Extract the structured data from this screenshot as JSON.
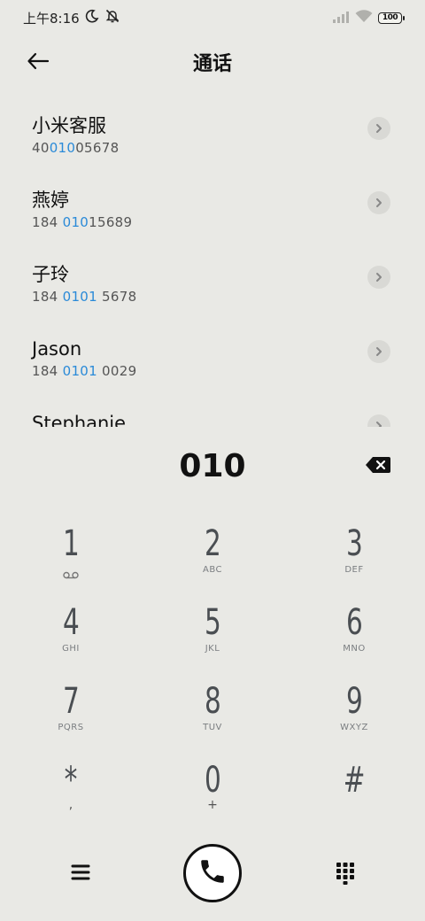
{
  "status_bar": {
    "time": "上午8:16",
    "battery": "100",
    "icons": [
      "moon-icon",
      "mute-bell-icon",
      "signal-icon",
      "wifi-icon",
      "battery-icon"
    ]
  },
  "header": {
    "title": "通话",
    "back_icon": "arrow-left-icon"
  },
  "contacts": [
    {
      "name": "小米客服",
      "number_pre": "40",
      "number_hl": "010",
      "number_post": "05678"
    },
    {
      "name": "燕婷",
      "number_pre": "184 ",
      "number_hl": "010",
      "number_post": "15689"
    },
    {
      "name": "子玲",
      "number_pre": "184 ",
      "number_hl": "0101",
      "number_post": " 5678"
    },
    {
      "name": "Jason",
      "number_pre": "184 ",
      "number_hl": "0101",
      "number_post": " 0029"
    },
    {
      "name": "Stephanie",
      "number_pre": "",
      "number_hl": "",
      "number_post": ""
    }
  ],
  "dialer": {
    "input": "010",
    "backspace_icon": "backspace-icon"
  },
  "keypad": [
    {
      "digit": "1",
      "letters": ""
    },
    {
      "digit": "2",
      "letters": "ABC"
    },
    {
      "digit": "3",
      "letters": "DEF"
    },
    {
      "digit": "4",
      "letters": "GHI"
    },
    {
      "digit": "5",
      "letters": "JKL"
    },
    {
      "digit": "6",
      "letters": "MNO"
    },
    {
      "digit": "7",
      "letters": "PQRS"
    },
    {
      "digit": "8",
      "letters": "TUV"
    },
    {
      "digit": "9",
      "letters": "WXYZ"
    },
    {
      "digit": "*",
      "letters": ","
    },
    {
      "digit": "0",
      "letters": "+"
    },
    {
      "digit": "#",
      "letters": ""
    }
  ],
  "bottom": {
    "menu_icon": "hamburger-menu-icon",
    "call_icon": "phone-icon",
    "dialpad_icon": "dialpad-icon"
  }
}
